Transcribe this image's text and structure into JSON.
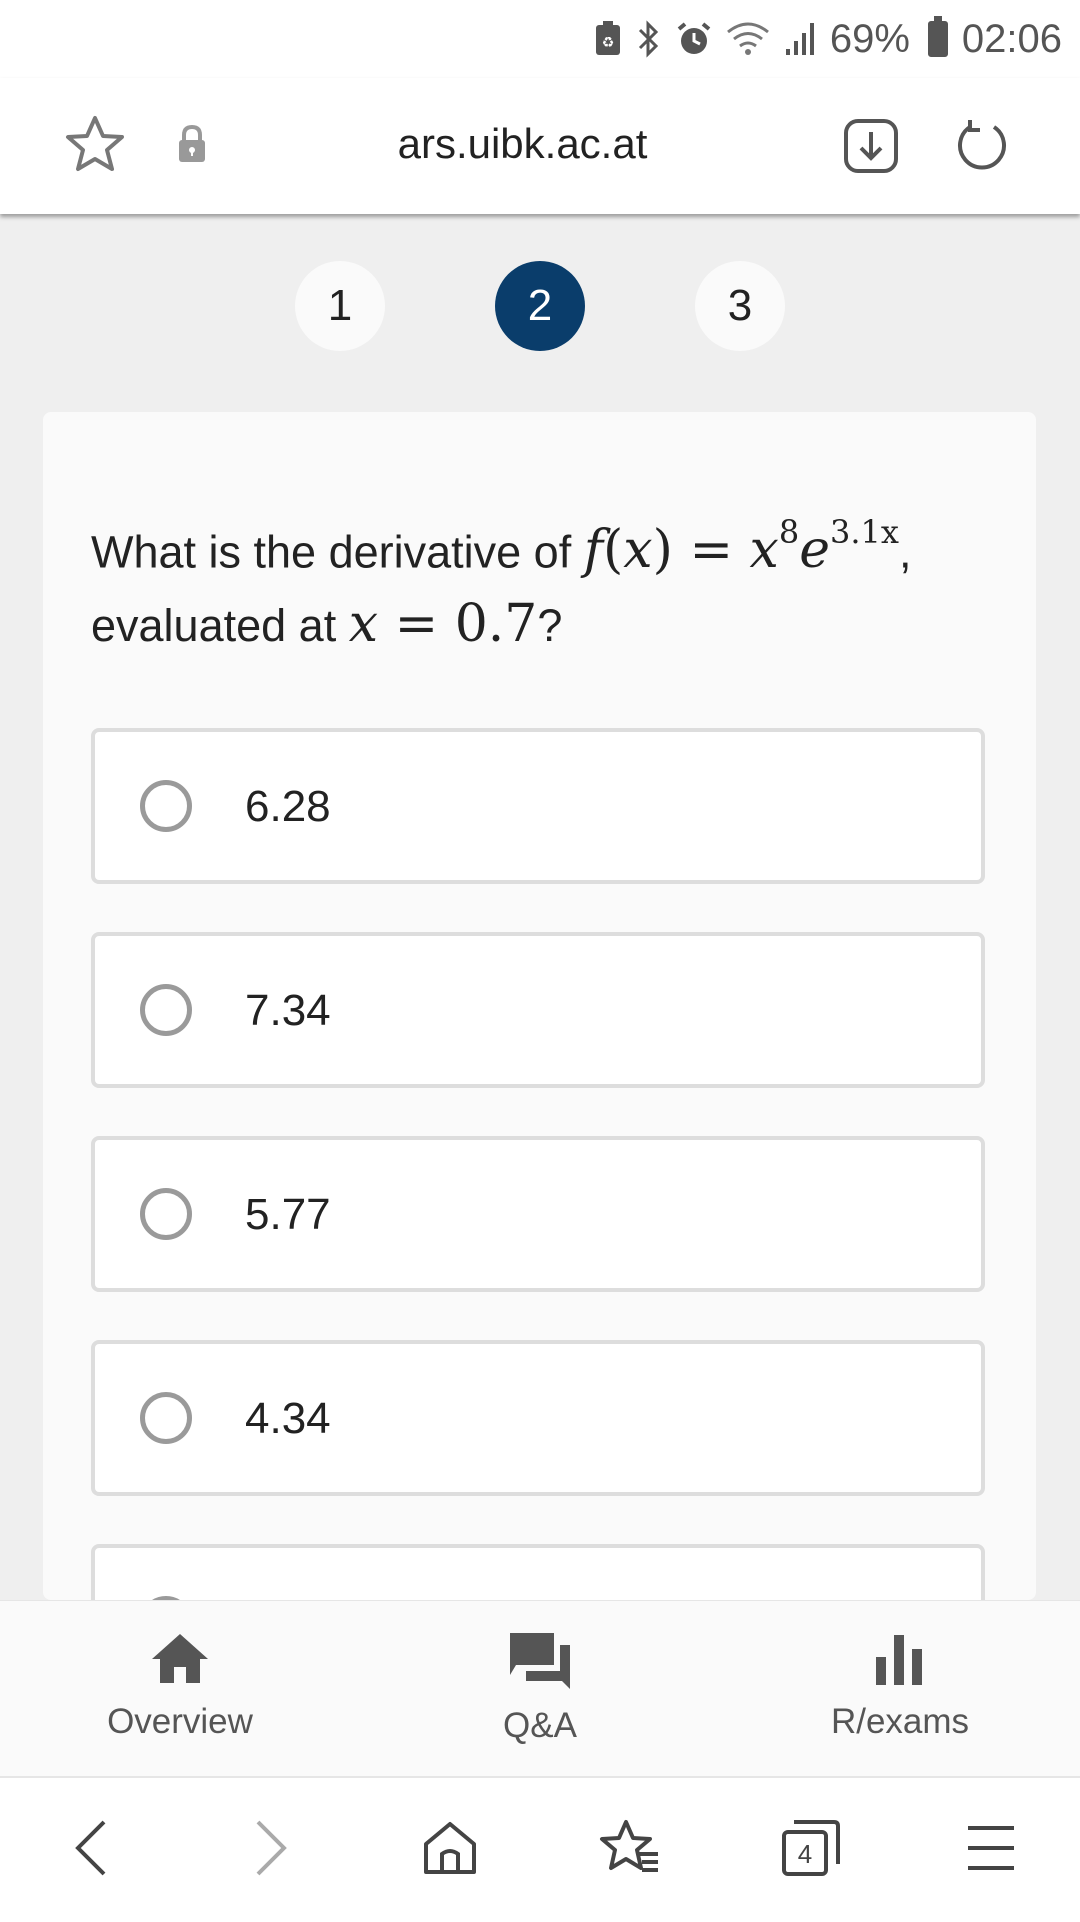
{
  "status_bar": {
    "battery_pct": "69%",
    "time": "02:06"
  },
  "browser": {
    "url": "ars.uibk.ac.at",
    "tabs_count": "4"
  },
  "pager": {
    "pages": [
      "1",
      "2",
      "3"
    ],
    "active_index": 1
  },
  "question": {
    "prefix": "What is the derivative of",
    "f": "f",
    "lparen": "(",
    "x": "x",
    "rparen": ")",
    "equals": "=",
    "base": "x",
    "exp1": "8",
    "e": "e",
    "exp2": "3.1x",
    "comma": ",",
    "line2_prefix": "evaluated at",
    "var": "x",
    "eq2": "=",
    "value": "0.7",
    "qmark": "?"
  },
  "options": [
    {
      "label": "6.28"
    },
    {
      "label": "7.34"
    },
    {
      "label": "5.77"
    },
    {
      "label": "4.34"
    }
  ],
  "app_nav": {
    "overview": "Overview",
    "qa": "Q&A",
    "rexams": "R/exams"
  },
  "colors": {
    "accent": "#0a3d6b",
    "background": "#efefef",
    "card": "#fafafa"
  }
}
